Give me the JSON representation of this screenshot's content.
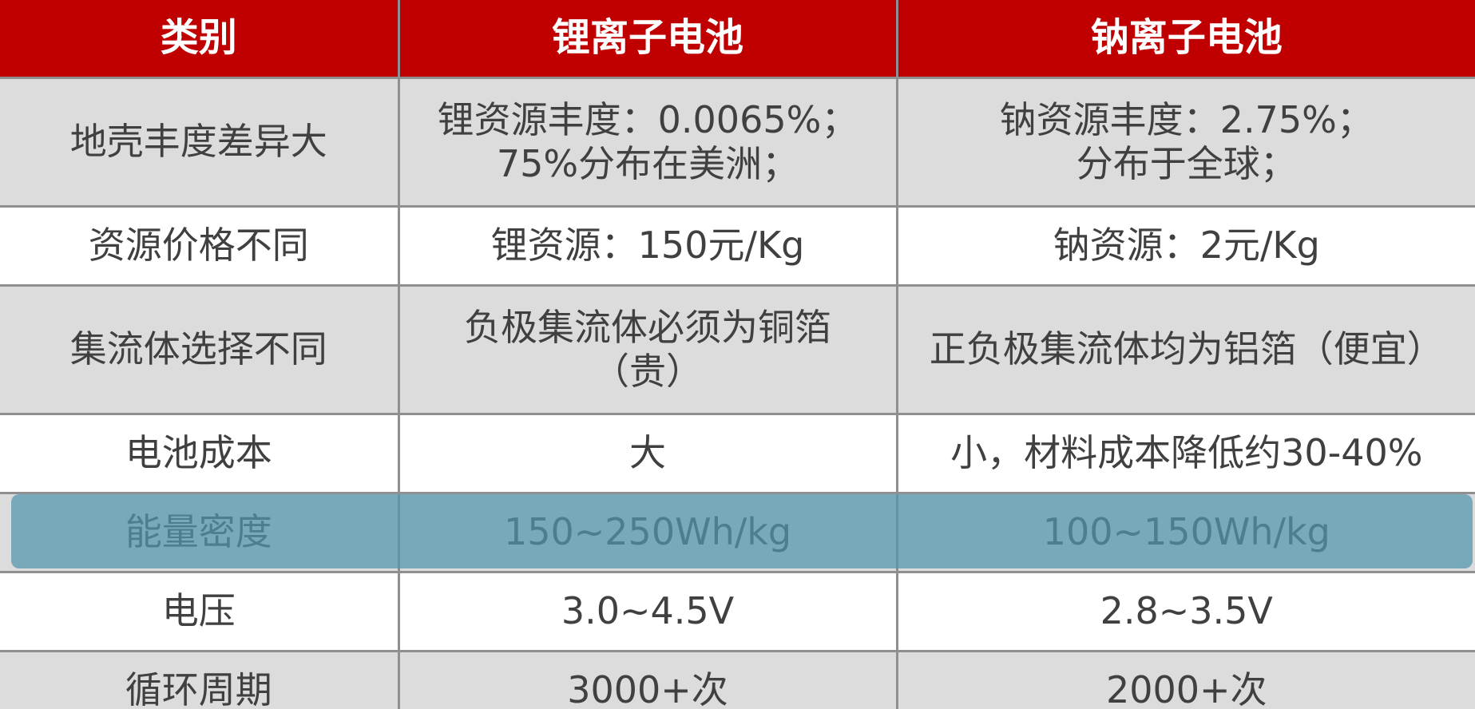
{
  "table": {
    "headers": [
      "类别",
      "锂离子电池",
      "钠离子电池"
    ],
    "rows": [
      {
        "category": "地壳丰度差异大",
        "lithium": [
          "锂资源丰度：0.0065%；",
          "75%分布在美洲；"
        ],
        "sodium": [
          "钠资源丰度：2.75%；",
          "分布于全球；"
        ]
      },
      {
        "category": "资源价格不同",
        "lithium": [
          "锂资源：150元/Kg"
        ],
        "sodium": [
          "钠资源：2元/Kg"
        ]
      },
      {
        "category": "集流体选择不同",
        "lithium": [
          "负极集流体必须为铜箔",
          "（贵）"
        ],
        "sodium": [
          "正负极集流体均为铝箔（便宜）"
        ]
      },
      {
        "category": "电池成本",
        "lithium": [
          "大"
        ],
        "sodium": [
          "小，材料成本降低约30-40%"
        ]
      },
      {
        "category": "能量密度",
        "lithium": [
          "150~250Wh/kg"
        ],
        "sodium": [
          "100~150Wh/kg"
        ]
      },
      {
        "category": "电压",
        "lithium": [
          "3.0~4.5V"
        ],
        "sodium": [
          "2.8~3.5V"
        ]
      },
      {
        "category": "循环周期",
        "lithium": [
          "3000+次"
        ],
        "sodium": [
          "2000+次"
        ]
      }
    ]
  },
  "colors": {
    "header_bg": "#c00000",
    "header_text": "#ffffff",
    "row_gray": "#dcdcdc",
    "row_white": "#ffffff",
    "highlight": "#5096af"
  }
}
